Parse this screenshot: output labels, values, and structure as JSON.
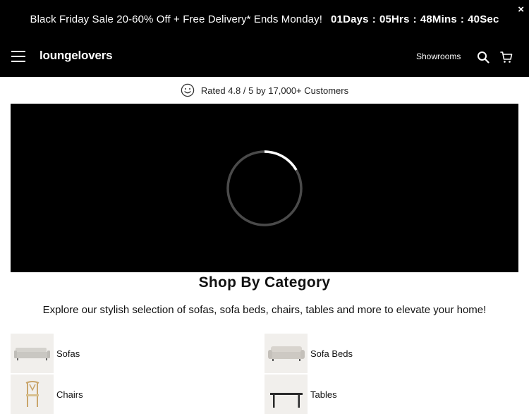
{
  "promo": {
    "message": "Black Friday Sale 20-60% Off + Free Delivery* Ends Monday!",
    "days": "01Days",
    "hours": "05Hrs",
    "mins": "48Mins",
    "secs": "40Sec",
    "separator": ":",
    "close_icon": "×"
  },
  "nav": {
    "logo": "loungelovers",
    "showrooms": "Showrooms",
    "icons": [
      "menu-icon",
      "search-icon",
      "cart-icon"
    ]
  },
  "rating": {
    "text": "Rated 4.8 / 5 by 17,000+ Customers",
    "icon": "smiley-icon"
  },
  "video": {
    "state": "loading",
    "icon": "spinner-icon"
  },
  "categories_section": {
    "title": "Shop By Category",
    "subtitle": "Explore our stylish selection of sofas, sofa beds, chairs, tables and more to elevate your home!",
    "items": [
      {
        "label": "Sofas",
        "icon": "sofa-thumbnail"
      },
      {
        "label": "Sofa Beds",
        "icon": "sofa-bed-thumbnail"
      },
      {
        "label": "Chairs",
        "icon": "chair-thumbnail"
      },
      {
        "label": "Tables",
        "icon": "table-thumbnail"
      }
    ]
  },
  "colors": {
    "bar_bg": "#000000",
    "text": "#111111",
    "thumb_bg": "#f1efec"
  }
}
